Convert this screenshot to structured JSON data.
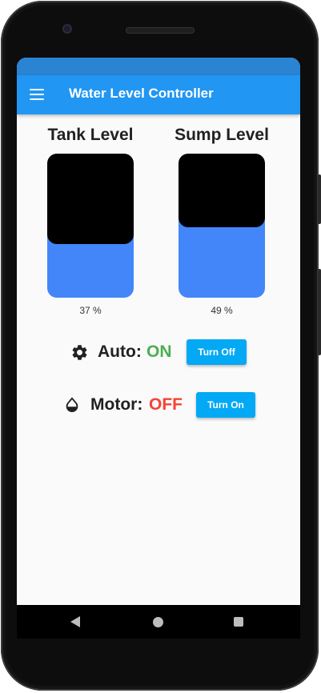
{
  "app_bar": {
    "title": "Water Level Controller",
    "menu_icon": "hamburger-menu-icon",
    "color": "#2196f3"
  },
  "tank": {
    "heading": "Tank Level",
    "level_percent": 37,
    "level_text": "37 %"
  },
  "sump": {
    "heading": "Sump Level",
    "level_percent": 49,
    "level_text": "49 %"
  },
  "auto": {
    "icon": "gear-icon",
    "label": "Auto:",
    "state": "ON",
    "state_color": "#4caf50",
    "button_label": "Turn Off"
  },
  "motor": {
    "icon": "water-drop-icon",
    "label": "Motor:",
    "state": "OFF",
    "state_color": "#f44336",
    "button_label": "Turn On"
  },
  "colors": {
    "water": "#4286f9",
    "button": "#03a9f4"
  },
  "nav_bar": {
    "back_icon": "back-triangle-icon",
    "home_icon": "home-circle-icon",
    "recents_icon": "recents-square-icon"
  }
}
